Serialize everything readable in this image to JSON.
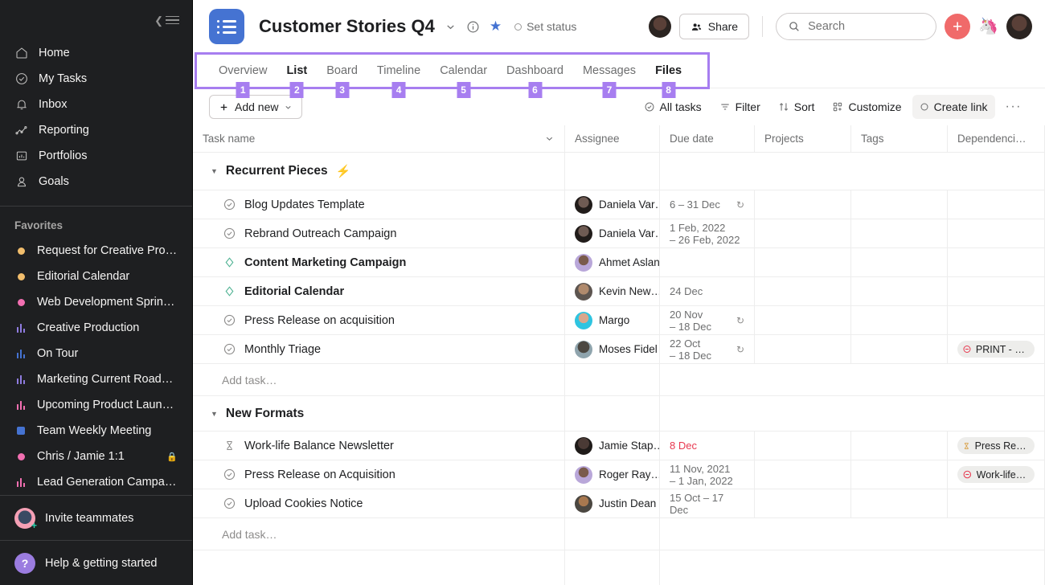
{
  "sidebar": {
    "collapse_label": "collapse-sidebar",
    "nav": [
      {
        "label": "Home",
        "icon": "home-icon"
      },
      {
        "label": "My Tasks",
        "icon": "check-circle-icon"
      },
      {
        "label": "Inbox",
        "icon": "bell-icon"
      },
      {
        "label": "Reporting",
        "icon": "chart-line-icon"
      },
      {
        "label": "Portfolios",
        "icon": "portfolio-icon"
      },
      {
        "label": "Goals",
        "icon": "goal-person-icon"
      }
    ],
    "favorites_title": "Favorites",
    "favorites": [
      {
        "label": "Request for Creative Pro…",
        "mark": "dot",
        "color": "#f1bd6c",
        "locked": false
      },
      {
        "label": "Editorial Calendar",
        "mark": "dot",
        "color": "#f1bd6c",
        "locked": false
      },
      {
        "label": "Web Development Sprint…",
        "mark": "dot",
        "color": "#f26fb1",
        "locked": false
      },
      {
        "label": "Creative Production",
        "mark": "bars",
        "color": "#8f7ce0",
        "locked": false
      },
      {
        "label": "On Tour",
        "mark": "bars",
        "color": "#4573d2",
        "locked": false
      },
      {
        "label": "Marketing Current Road…",
        "mark": "bars",
        "color": "#8f7ce0",
        "locked": false
      },
      {
        "label": "Upcoming Product Laun…",
        "mark": "bars",
        "color": "#f26fb1",
        "locked": false
      },
      {
        "label": "Team Weekly Meeting",
        "mark": "square",
        "color": "#4573d2",
        "locked": false
      },
      {
        "label": "Chris / Jamie 1:1",
        "mark": "dot",
        "color": "#f26fb1",
        "locked": true
      },
      {
        "label": "Lead Generation Campai…",
        "mark": "bars",
        "color": "#f26fb1",
        "locked": false
      }
    ],
    "invite_label": "Invite teammates",
    "help_label": "Help & getting started",
    "help_glyph": "?"
  },
  "header": {
    "project_title": "Customer Stories Q4",
    "chevron": "chevron-down-icon",
    "info": "info-icon",
    "star": "star-icon",
    "set_status": "Set status",
    "share_label": "Share",
    "search_placeholder": "Search",
    "plus_label": "+"
  },
  "tabs": {
    "items": [
      {
        "label": "Overview",
        "badge": "1",
        "state": "normal"
      },
      {
        "label": "List",
        "badge": "2",
        "state": "active"
      },
      {
        "label": "Board",
        "badge": "3",
        "state": "normal"
      },
      {
        "label": "Timeline",
        "badge": "4",
        "state": "normal"
      },
      {
        "label": "Calendar",
        "badge": "5",
        "state": "normal"
      },
      {
        "label": "Dashboard",
        "badge": "6",
        "state": "normal"
      },
      {
        "label": "Messages",
        "badge": "7",
        "state": "normal"
      },
      {
        "label": "Files",
        "badge": "8",
        "state": "under"
      }
    ],
    "highlight_color": "#a77ef0"
  },
  "toolbar": {
    "add_new": "Add new",
    "all_tasks": "All tasks",
    "filter": "Filter",
    "sort": "Sort",
    "customize": "Customize",
    "create_link": "Create link",
    "more": "···"
  },
  "table": {
    "columns": [
      "Task name",
      "Assignee",
      "Due date",
      "Projects",
      "Tags",
      "Dependenci…"
    ],
    "add_task_label": "Add task…",
    "sections": [
      {
        "name": "Recurrent Pieces",
        "badge_icon": "lightning-bolt-icon",
        "tasks": [
          {
            "name": "Blog Updates Template",
            "bold": false,
            "icon": "check-circle-icon",
            "assignee": "Daniela Var…",
            "avatar": "#6f5b53",
            "due": "6 – 31 Dec",
            "due2": "",
            "overdue": false,
            "recurring": true,
            "recur_inline": true,
            "projects": "",
            "tags": "",
            "dependency": "",
            "dep_icon": ""
          },
          {
            "name": "Rebrand Outreach Campaign",
            "bold": false,
            "icon": "check-circle-icon",
            "assignee": "Daniela Var…",
            "avatar": "#6f5b53",
            "due": "1 Feb, 2022",
            "due2": "– 26 Feb, 2022",
            "overdue": false,
            "recurring": false,
            "recur_inline": false,
            "projects": "",
            "tags": "",
            "dependency": "",
            "dep_icon": ""
          },
          {
            "name": "Content Marketing Campaign",
            "bold": true,
            "icon": "milestone-diamond-icon",
            "assignee": "Ahmet Aslan",
            "avatar": "#b9a7d9",
            "due": "",
            "due2": "",
            "overdue": false,
            "recurring": false,
            "recur_inline": false,
            "projects": "",
            "tags": "",
            "dependency": "",
            "dep_icon": ""
          },
          {
            "name": "Editorial Calendar",
            "bold": true,
            "icon": "milestone-diamond-icon",
            "assignee": "Kevin New…",
            "avatar": "#8a6f5e",
            "due": "24 Dec",
            "due2": "",
            "overdue": false,
            "recurring": false,
            "recur_inline": false,
            "projects": "",
            "tags": "",
            "dependency": "",
            "dep_icon": ""
          },
          {
            "name": "Press Release on acquisition",
            "bold": false,
            "icon": "check-circle-icon",
            "assignee": "Margo",
            "avatar": "#2ec4e0",
            "due": "20 Nov",
            "due2": "– 18 Dec",
            "overdue": false,
            "recurring": true,
            "recur_inline": false,
            "projects": "",
            "tags": "",
            "dependency": "",
            "dep_icon": ""
          },
          {
            "name": "Monthly Triage",
            "bold": false,
            "icon": "check-circle-icon",
            "assignee": "Moses Fidel",
            "avatar": "#4b4741",
            "due": "22 Oct",
            "due2": "– 18 Dec",
            "overdue": false,
            "recurring": true,
            "recur_inline": false,
            "projects": "",
            "tags": "",
            "dependency": "PRINT - R…",
            "dep_icon": "blocked-icon"
          }
        ]
      },
      {
        "name": "New Formats",
        "badge_icon": "",
        "tasks": [
          {
            "name": "Work-life Balance Newsletter",
            "bold": false,
            "icon": "hourglass-icon",
            "assignee": "Jamie Stap…",
            "avatar": "#4a3a35",
            "due": "8 Dec",
            "due2": "",
            "overdue": true,
            "recurring": false,
            "recur_inline": false,
            "projects": "",
            "tags": "",
            "dependency": "Press Rele…",
            "dep_icon": "hourglass-icon"
          },
          {
            "name": "Press Release on Acquisition",
            "bold": false,
            "icon": "check-circle-icon",
            "assignee": "Roger Ray…",
            "avatar": "#b9a7d9",
            "due": "11 Nov, 2021",
            "due2": "– 1 Jan, 2022",
            "overdue": false,
            "recurring": false,
            "recur_inline": false,
            "projects": "",
            "tags": "",
            "dependency": "Work-life …",
            "dep_icon": "blocked-icon"
          },
          {
            "name": "Upload Cookies Notice",
            "bold": false,
            "icon": "check-circle-icon",
            "assignee": "Justin Dean",
            "avatar": "#7b6250",
            "due": "15 Oct – 17 Dec",
            "due2": "",
            "overdue": false,
            "recurring": false,
            "recur_inline": false,
            "projects": "",
            "tags": "",
            "dependency": "",
            "dep_icon": ""
          }
        ]
      }
    ]
  }
}
